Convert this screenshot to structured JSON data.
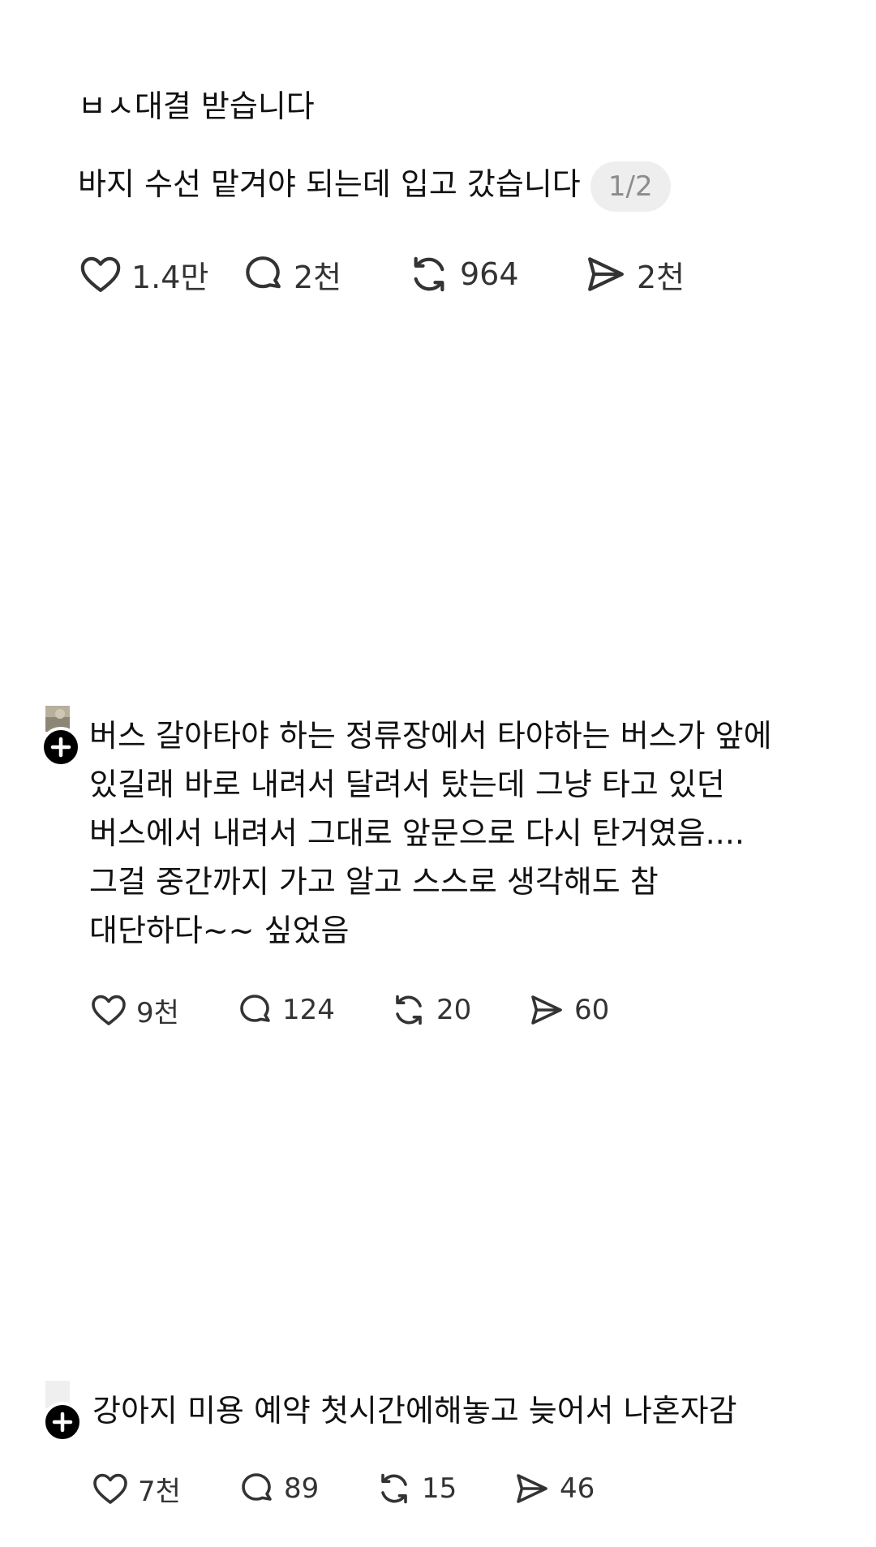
{
  "posts": [
    {
      "lines": [
        "ㅂㅅ대결 받습니다",
        "바지 수선 맡겨야 되는데 입고 갔습니다"
      ],
      "page_indicator": "1/2",
      "counts": {
        "likes": "1.4만",
        "replies": "2천",
        "reposts": "964",
        "shares": "2천"
      }
    },
    {
      "lines": [
        "버스 갈아타야 하는 정류장에서 타야하는 버스가 앞에",
        "있길래 바로 내려서 달려서 탔는데 그냥 타고 있던",
        "버스에서 내려서 그대로 앞문으로 다시 탄거였음....",
        "그걸 중간까지 가고 알고 스스로 생각해도 참",
        "대단하다~~ 싶었음"
      ],
      "counts": {
        "likes": "9천",
        "replies": "124",
        "reposts": "20",
        "shares": "60"
      }
    },
    {
      "lines": [
        "강아지 미용 예약 첫시간에해놓고 늦어서 나혼자감"
      ],
      "counts": {
        "likes": "7천",
        "replies": "89",
        "reposts": "15",
        "shares": "46"
      }
    }
  ],
  "icons": {
    "like": "heart-icon",
    "reply": "speech-bubble-icon",
    "repost": "repost-arrows-icon",
    "share": "paper-plane-icon",
    "follow": "plus-icon"
  },
  "colors": {
    "text": "#111111",
    "count": "#333333",
    "pill_bg": "#eeeeee",
    "pill_text": "#8c8c8c"
  }
}
